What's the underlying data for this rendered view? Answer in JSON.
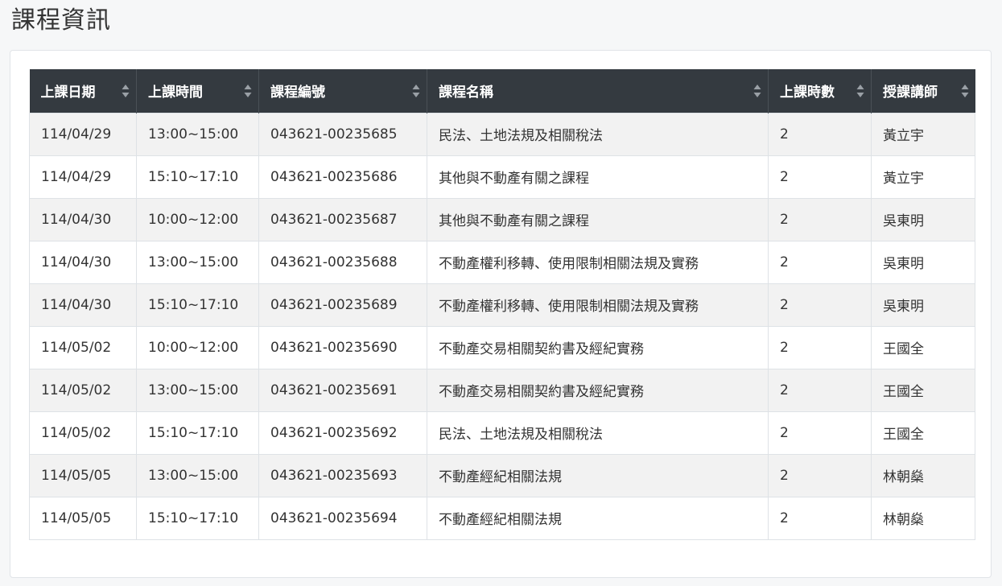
{
  "page": {
    "title": "課程資訊"
  },
  "table": {
    "columns": [
      "上課日期",
      "上課時間",
      "課程編號",
      "課程名稱",
      "上課時數",
      "授課講師"
    ],
    "rows": [
      [
        "114/04/29",
        "13:00~15:00",
        "043621-00235685",
        "民法、土地法規及相關稅法",
        "2",
        "黃立宇"
      ],
      [
        "114/04/29",
        "15:10~17:10",
        "043621-00235686",
        "其他與不動產有關之課程",
        "2",
        "黃立宇"
      ],
      [
        "114/04/30",
        "10:00~12:00",
        "043621-00235687",
        "其他與不動產有關之課程",
        "2",
        "吳東明"
      ],
      [
        "114/04/30",
        "13:00~15:00",
        "043621-00235688",
        "不動產權利移轉、使用限制相關法規及實務",
        "2",
        "吳東明"
      ],
      [
        "114/04/30",
        "15:10~17:10",
        "043621-00235689",
        "不動產權利移轉、使用限制相關法規及實務",
        "2",
        "吳東明"
      ],
      [
        "114/05/02",
        "10:00~12:00",
        "043621-00235690",
        "不動產交易相關契約書及經紀實務",
        "2",
        "王國全"
      ],
      [
        "114/05/02",
        "13:00~15:00",
        "043621-00235691",
        "不動產交易相關契約書及經紀實務",
        "2",
        "王國全"
      ],
      [
        "114/05/02",
        "15:10~17:10",
        "043621-00235692",
        "民法、土地法規及相關稅法",
        "2",
        "王國全"
      ],
      [
        "114/05/05",
        "13:00~15:00",
        "043621-00235693",
        "不動產經紀相關法規",
        "2",
        "林朝燊"
      ],
      [
        "114/05/05",
        "15:10~17:10",
        "043621-00235694",
        "不動產經紀相關法規",
        "2",
        "林朝燊"
      ]
    ]
  },
  "icons": {
    "sort": "sort-icon"
  },
  "colors": {
    "header_bg": "#343a40",
    "header_text": "#ffffff",
    "row_stripe": "#f2f2f2",
    "border": "#dee2e6"
  }
}
